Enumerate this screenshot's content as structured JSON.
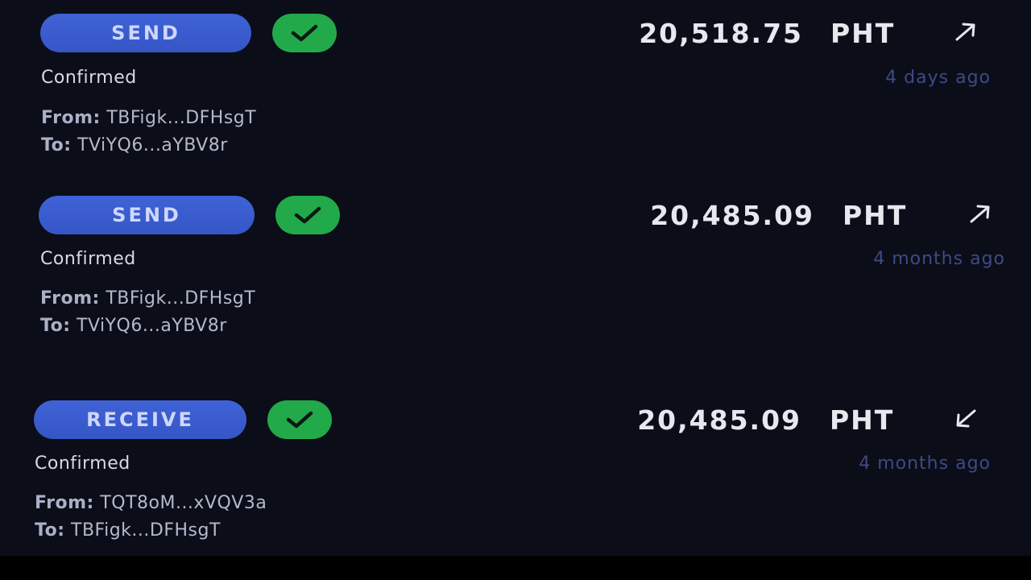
{
  "transactions": [
    {
      "type_label": "SEND",
      "status": "Confirmed",
      "amount": "20,518.75",
      "currency": "PHT",
      "direction_icon": "arrow-up-right-icon",
      "time": "4 days ago",
      "from_label": "From:",
      "from": "TBFigk...DFHsgT",
      "to_label": "To:",
      "to": "TViYQ6...aYBV8r"
    },
    {
      "type_label": "SEND",
      "status": "Confirmed",
      "amount": "20,485.09",
      "currency": "PHT",
      "direction_icon": "arrow-up-right-icon",
      "time": "4 months ago",
      "from_label": "From:",
      "from": "TBFigk...DFHsgT",
      "to_label": "To:",
      "to": "TViYQ6...aYBV8r"
    },
    {
      "type_label": "RECEIVE",
      "status": "Confirmed",
      "amount": "20,485.09",
      "currency": "PHT",
      "direction_icon": "arrow-down-left-icon",
      "time": "4 months ago",
      "from_label": "From:",
      "from": "TQT8oM...xVQV3a",
      "to_label": "To:",
      "to": "TBFigk...DFHsgT"
    }
  ],
  "colors": {
    "pill": "#3f62d6",
    "check": "#22a94a",
    "time": "#3e4a86",
    "background": "#0b0d18"
  }
}
